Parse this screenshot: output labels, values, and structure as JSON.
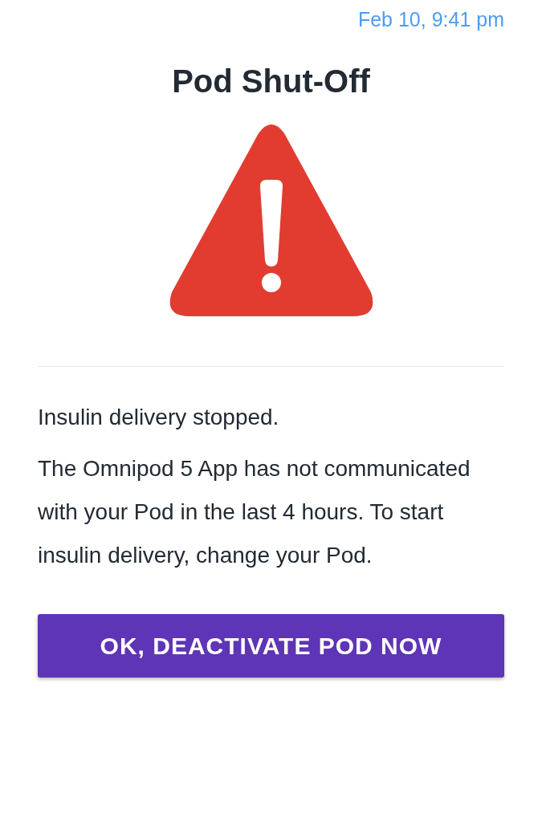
{
  "timestamp": "Feb 10, 9:41 pm",
  "title": "Pod Shut-Off",
  "alert": {
    "kind": "warning"
  },
  "message": [
    "Insulin delivery stopped.",
    "The Omnipod 5 App has not communicated with your Pod in the last 4 hours. To start insulin delivery, change your Pod."
  ],
  "buttons": [
    "OK, DEACTIVATE POD NOW"
  ]
}
